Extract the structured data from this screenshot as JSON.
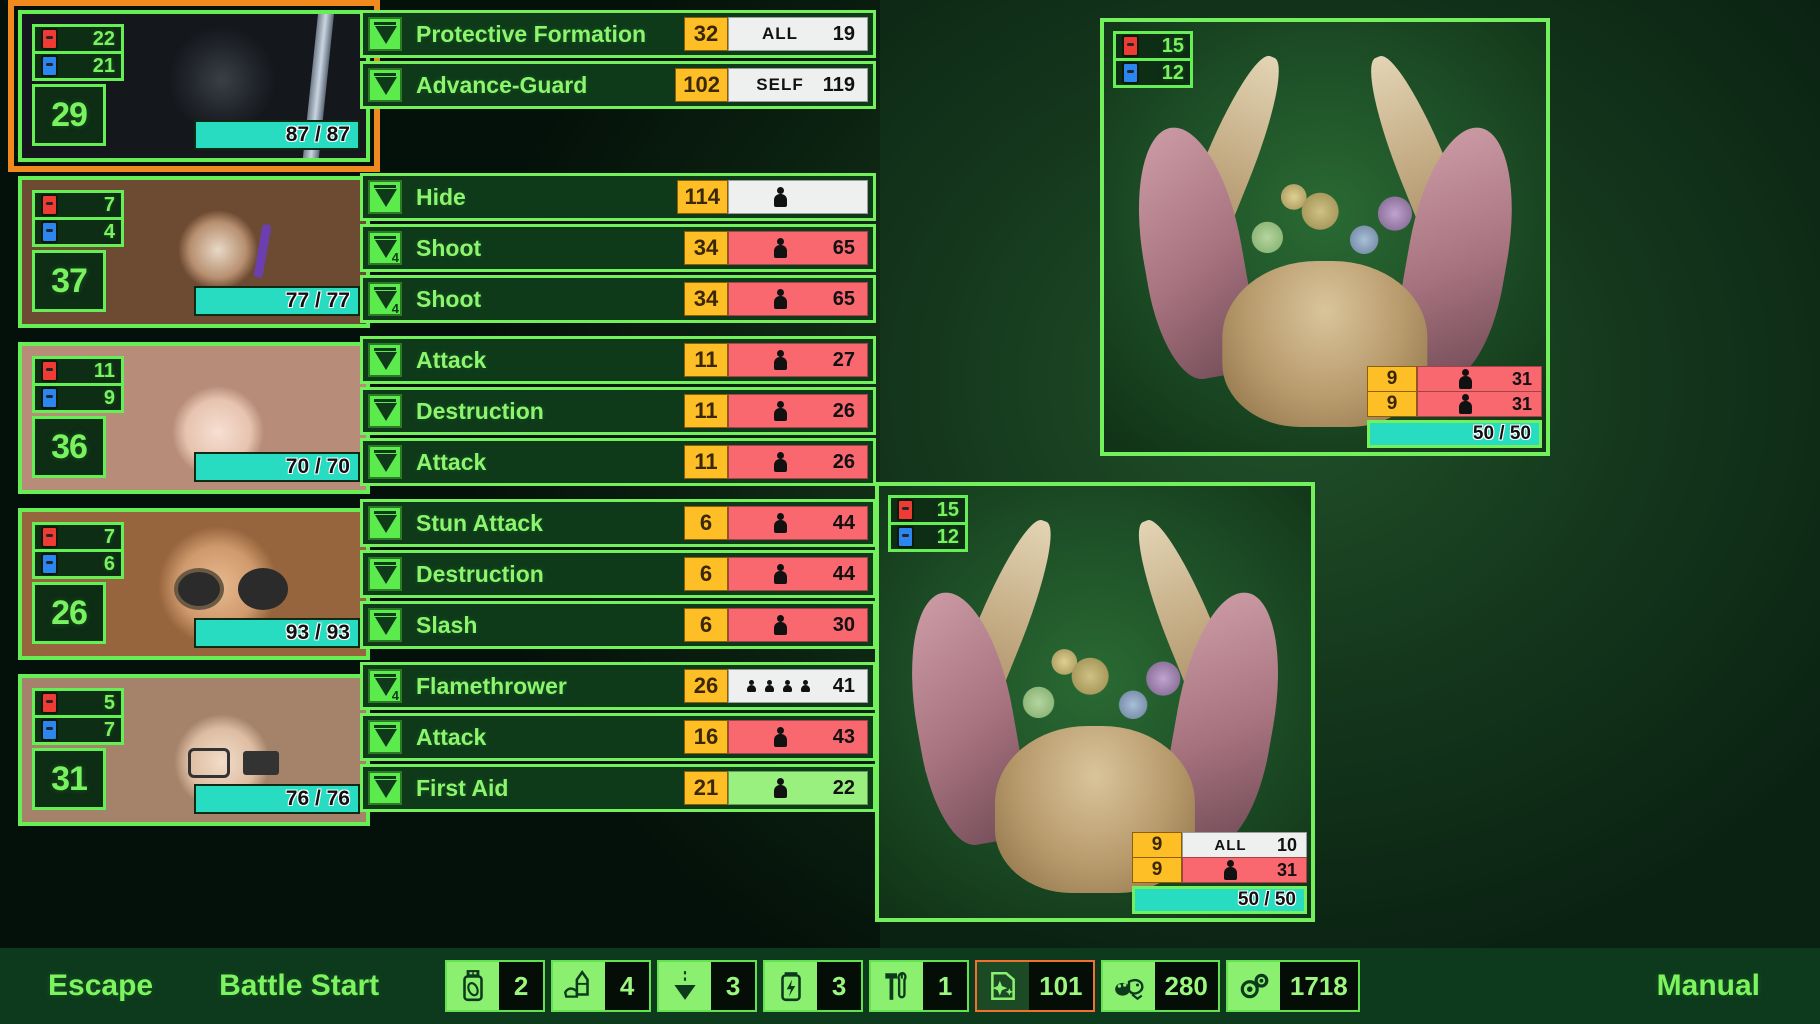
{
  "party": [
    {
      "name": "ally-1",
      "red_cards": "22",
      "blue_cards": "21",
      "speed": "29",
      "hp": "87 / 87",
      "active": true,
      "skills": [
        {
          "name": "Protective Formation",
          "cost": "32",
          "target_label": "ALL",
          "target_value": "19",
          "target_kind": "buff",
          "icon": "skill-triangle-icon",
          "charges": ""
        },
        {
          "name": "Advance-Guard",
          "cost": "102",
          "target_label": "SELF",
          "target_value": "119",
          "target_kind": "buff",
          "icon": "skill-triangle-icon",
          "charges": ""
        }
      ]
    },
    {
      "name": "ally-2",
      "red_cards": "7",
      "blue_cards": "4",
      "speed": "37",
      "hp": "77 / 77",
      "active": false,
      "skills": [
        {
          "name": "Hide",
          "cost": "114",
          "target_label": "",
          "target_value": "",
          "target_kind": "buff",
          "icon": "skill-triangle-icon",
          "charges": "",
          "person": 1
        },
        {
          "name": "Shoot",
          "cost": "34",
          "target_label": "",
          "target_value": "65",
          "target_kind": "dmg",
          "icon": "skill-triangle-icon",
          "charges": "4",
          "person": 1
        },
        {
          "name": "Shoot",
          "cost": "34",
          "target_label": "",
          "target_value": "65",
          "target_kind": "dmg",
          "icon": "skill-triangle-icon",
          "charges": "4",
          "person": 1
        }
      ]
    },
    {
      "name": "ally-3",
      "red_cards": "11",
      "blue_cards": "9",
      "speed": "36",
      "hp": "70 / 70",
      "active": false,
      "skills": [
        {
          "name": "Attack",
          "cost": "11",
          "target_label": "",
          "target_value": "27",
          "target_kind": "dmg",
          "icon": "skill-triangle-icon",
          "charges": "",
          "person": 1
        },
        {
          "name": "Destruction",
          "cost": "11",
          "target_label": "",
          "target_value": "26",
          "target_kind": "dmg",
          "icon": "skill-triangle-icon",
          "charges": "",
          "person": 1
        },
        {
          "name": "Attack",
          "cost": "11",
          "target_label": "",
          "target_value": "26",
          "target_kind": "dmg",
          "icon": "skill-triangle-icon",
          "charges": "",
          "person": 1
        }
      ]
    },
    {
      "name": "ally-4",
      "red_cards": "7",
      "blue_cards": "6",
      "speed": "26",
      "hp": "93 / 93",
      "active": false,
      "skills": [
        {
          "name": "Stun Attack",
          "cost": "6",
          "target_label": "",
          "target_value": "44",
          "target_kind": "dmg",
          "icon": "skill-triangle-icon",
          "charges": "",
          "person": 1
        },
        {
          "name": "Destruction",
          "cost": "6",
          "target_label": "",
          "target_value": "44",
          "target_kind": "dmg",
          "icon": "skill-triangle-icon",
          "charges": "",
          "person": 1
        },
        {
          "name": "Slash",
          "cost": "6",
          "target_label": "",
          "target_value": "30",
          "target_kind": "dmg",
          "icon": "skill-triangle-icon",
          "charges": "",
          "person": 1
        }
      ]
    },
    {
      "name": "ally-5",
      "red_cards": "5",
      "blue_cards": "7",
      "speed": "31",
      "hp": "76 / 76",
      "active": false,
      "skills": [
        {
          "name": "Flamethrower",
          "cost": "26",
          "target_label": "",
          "target_value": "41",
          "target_kind": "buff",
          "icon": "skill-triangle-icon",
          "charges": "4",
          "person": 4
        },
        {
          "name": "Attack",
          "cost": "16",
          "target_label": "",
          "target_value": "43",
          "target_kind": "dmg",
          "icon": "skill-triangle-icon",
          "charges": "",
          "person": 1
        },
        {
          "name": "First Aid",
          "cost": "21",
          "target_label": "",
          "target_value": "22",
          "target_kind": "heal",
          "icon": "skill-triangle-icon",
          "charges": "",
          "person": 1
        }
      ]
    }
  ],
  "enemies": [
    {
      "name": "enemy-1",
      "red_cards": "15",
      "blue_cards": "12",
      "hp": "50 / 50",
      "actions": [
        {
          "cost": "9",
          "target_label": "",
          "target_value": "31",
          "target_kind": "dmg",
          "person": 1
        },
        {
          "cost": "9",
          "target_label": "",
          "target_value": "31",
          "target_kind": "dmg",
          "person": 1
        }
      ]
    },
    {
      "name": "enemy-2",
      "red_cards": "15",
      "blue_cards": "12",
      "hp": "50 / 50",
      "actions": [
        {
          "cost": "9",
          "target_label": "ALL",
          "target_value": "10",
          "target_kind": "buff",
          "person": 0
        },
        {
          "cost": "9",
          "target_label": "",
          "target_value": "31",
          "target_kind": "dmg",
          "person": 1
        }
      ]
    }
  ],
  "bottom_bar": {
    "escape_label": "Escape",
    "battle_start_label": "Battle Start",
    "manual_label": "Manual",
    "resources": [
      {
        "icon": "medicine-bottle-icon",
        "count": "2",
        "selected": false
      },
      {
        "icon": "bullet-ammo-icon",
        "count": "4",
        "selected": false
      },
      {
        "icon": "funnel-flask-icon",
        "count": "3",
        "selected": false
      },
      {
        "icon": "battery-icon",
        "count": "3",
        "selected": false
      },
      {
        "icon": "hammer-wrench-icon",
        "count": "1",
        "selected": false
      },
      {
        "icon": "sparkle-card-icon",
        "count": "101",
        "selected": true
      },
      {
        "icon": "slime-creature-icon",
        "count": "280",
        "selected": false
      },
      {
        "icon": "gears-icon",
        "count": "1718",
        "selected": false
      }
    ]
  },
  "colors": {
    "green_frame": "#74f05c",
    "green_text": "#8cf56e",
    "panel_bg": "#0e3a1a",
    "cost_yellow": "#fdbe26",
    "damage_red": "#f9676f",
    "buff_white": "#eef0ef",
    "heal_green": "#99f07e",
    "hp_teal": "#27dcc0",
    "active_orange": "#f08a1e",
    "card_red": "#ee3b33",
    "card_blue": "#2b86f0"
  }
}
